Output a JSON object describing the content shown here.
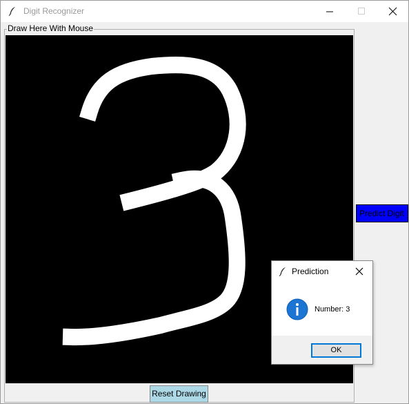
{
  "window": {
    "title": "Digit Recognizer",
    "icon": "feather-icon",
    "controls": [
      "minimize-icon",
      "maximize-icon",
      "close-icon"
    ]
  },
  "frame": {
    "label": "Draw Here With Mouse"
  },
  "canvas": {
    "background": "#000000",
    "stroke_color": "#ffffff",
    "drawn_digit": "3"
  },
  "buttons": {
    "predict_label": "Predict Digit",
    "predict_bg": "#0000ff",
    "reset_label": "Reset Drawing",
    "reset_bg": "#add8e6"
  },
  "dialog": {
    "title": "Prediction",
    "icon": "info-icon",
    "message": "Number: 3",
    "ok_label": "OK"
  }
}
